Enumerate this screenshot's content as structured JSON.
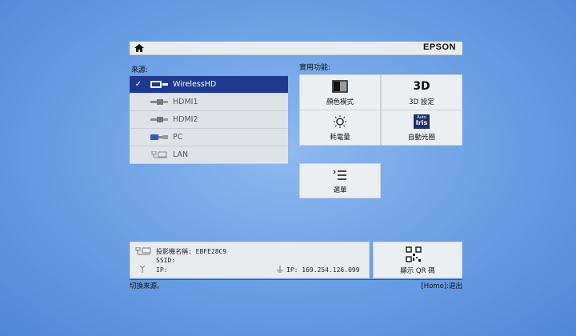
{
  "header": {
    "brand": "EPSON"
  },
  "sources": {
    "label": "來源:",
    "items": [
      {
        "label": "WirelessHD",
        "selected": true
      },
      {
        "label": "HDMI1",
        "selected": false
      },
      {
        "label": "HDMI2",
        "selected": false
      },
      {
        "label": "PC",
        "selected": false
      },
      {
        "label": "LAN",
        "selected": false
      }
    ]
  },
  "features": {
    "label": "實用功能:",
    "tiles": [
      {
        "label": "顏色模式",
        "icon": "color-mode-icon"
      },
      {
        "label": "3D 設定",
        "icon": "3d-icon"
      },
      {
        "label": "耗電量",
        "icon": "power-consumption-icon"
      },
      {
        "label": "自動光圈",
        "icon": "auto-iris-icon"
      },
      {
        "label": "選單",
        "icon": "menu-list-icon"
      }
    ],
    "icon_text": {
      "three_d": "3D",
      "auto": "Auto",
      "iris": "Iris"
    }
  },
  "info": {
    "projector_name_label": "投影機名稱: EBFE28C9",
    "ssid_label": "SSID:",
    "ip_label": "IP:",
    "ip_right_label": "IP: 169.254.126.099"
  },
  "qr": {
    "label": "顯示 QR 碼"
  },
  "status": {
    "left": "切換來源。",
    "right": "[Home]:退出"
  },
  "colors": {
    "selected": "#1e3a8f",
    "panel": "#e9ecef"
  }
}
